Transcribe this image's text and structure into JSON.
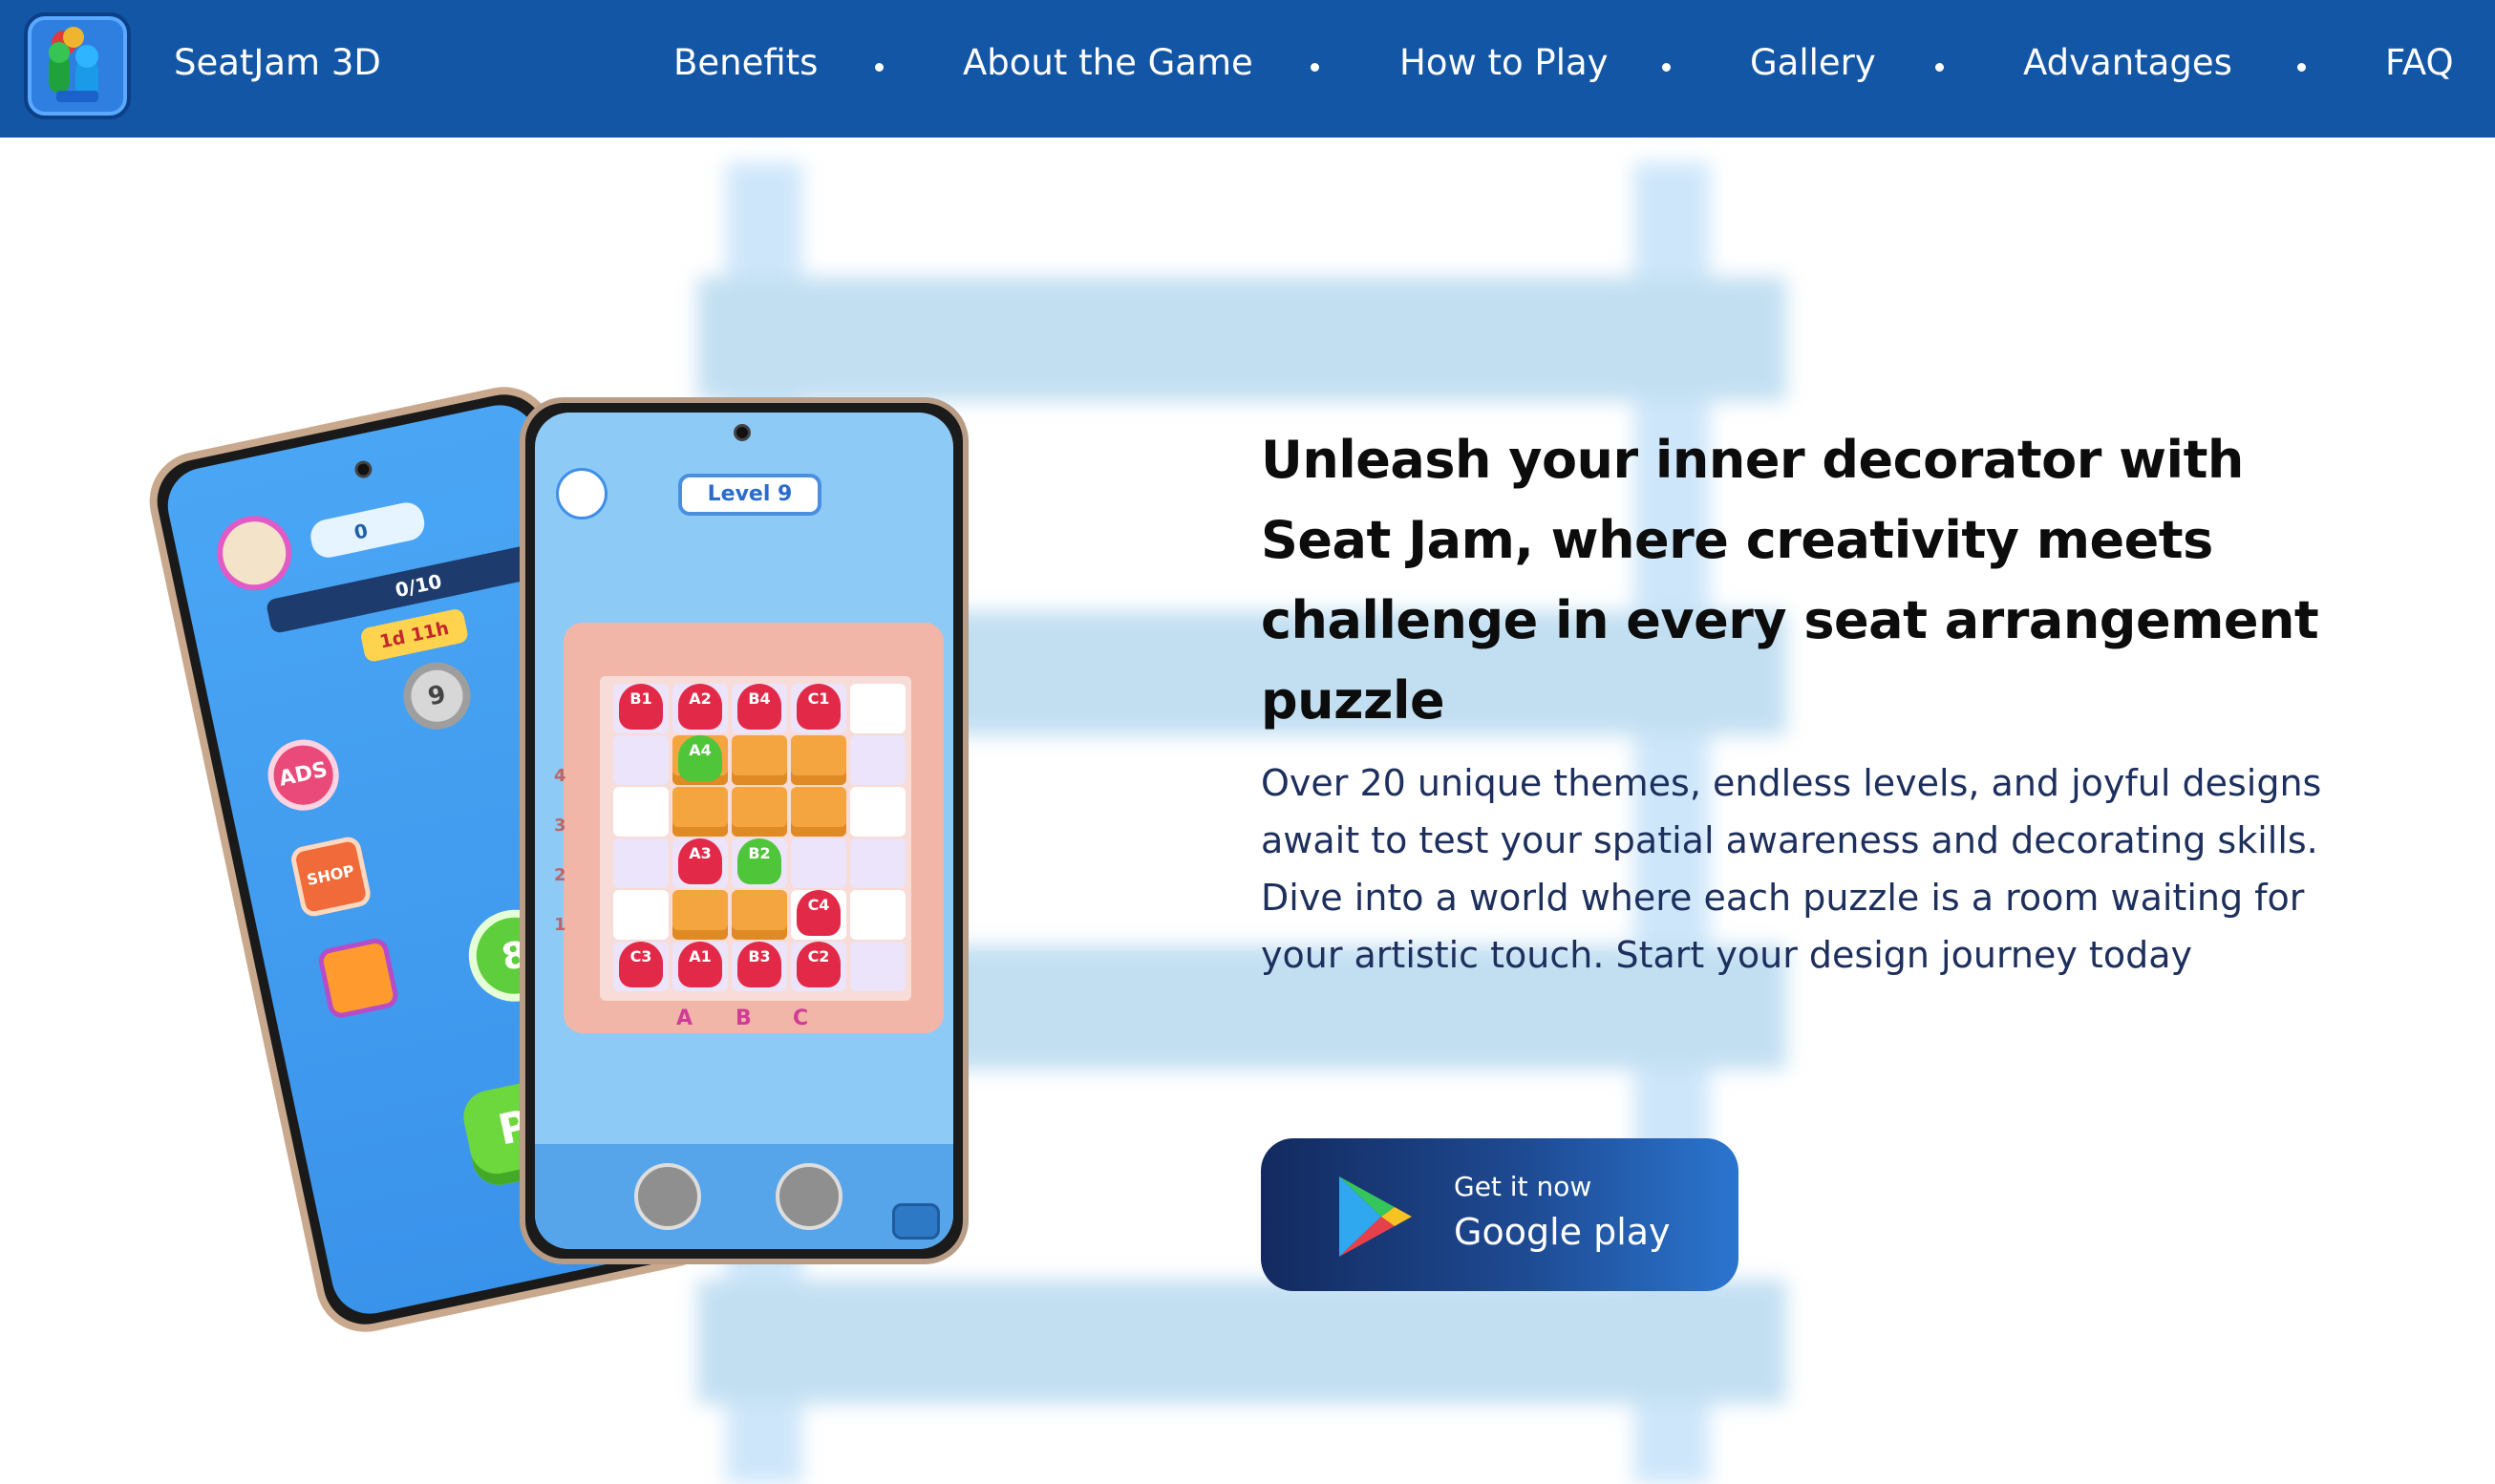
{
  "brand": {
    "name": "SeatJam 3D",
    "logo_icon": "app-logo-icon"
  },
  "nav": {
    "items": [
      {
        "label": "Benefits"
      },
      {
        "label": "About the Game"
      },
      {
        "label": "How to Play"
      },
      {
        "label": "Gallery"
      },
      {
        "label": "Advantages"
      },
      {
        "label": "FAQ"
      }
    ]
  },
  "hero": {
    "title": "Unleash your inner decorator with Seat Jam, where creativity meets challenge in every seat arrangement puzzle",
    "body": "Over 20 unique themes, endless levels, and joyful designs await to test your spatial awareness and decorating skills. Dive into a world where each puzzle is a room waiting for your artistic touch. Start your design journey today",
    "cta": {
      "small": "Get it now",
      "big": "Google play",
      "icon": "google-play-icon"
    }
  },
  "phone_front": {
    "level": "Level 9",
    "columns": [
      "A",
      "B",
      "C"
    ],
    "rows": [
      "4",
      "3",
      "2",
      "1"
    ],
    "characters": [
      {
        "label": "B1",
        "color": "red"
      },
      {
        "label": "A2",
        "color": "red"
      },
      {
        "label": "B4",
        "color": "red"
      },
      {
        "label": "C1",
        "color": "red"
      },
      {
        "label": "A4",
        "color": "green"
      },
      {
        "label": "A3",
        "color": "red"
      },
      {
        "label": "B2",
        "color": "green"
      },
      {
        "label": "C4",
        "color": "red"
      },
      {
        "label": "C3",
        "color": "red"
      },
      {
        "label": "A1",
        "color": "red"
      },
      {
        "label": "B3",
        "color": "red"
      },
      {
        "label": "C2",
        "color": "red"
      }
    ]
  },
  "phone_back": {
    "gems": "0",
    "progress": "0/10",
    "timer": "1d 11h",
    "ads_label": "ADS",
    "shop_label": "SHOP",
    "current_level": "8",
    "prev_level": "9",
    "play_label": "PLA"
  },
  "colors": {
    "nav_bg": "#1356a5",
    "cta_start": "#132a5f",
    "cta_end": "#2b75cf",
    "title": "#0c0c0c",
    "body": "#1d2f5c"
  }
}
